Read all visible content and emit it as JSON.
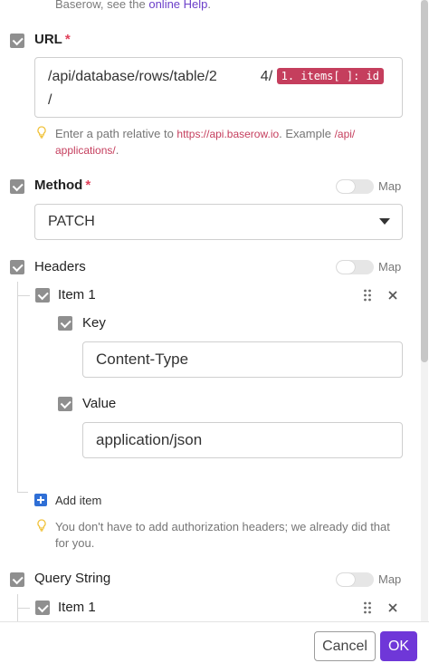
{
  "intro": {
    "text": "Baserow, see the ",
    "link": "online Help",
    "tail": "."
  },
  "url_field": {
    "label": "URL",
    "required_mark": "*",
    "value_prefix": "/api/database/rows/table/2",
    "value_suffix": "4/",
    "token": "1. items[ ]: id",
    "value_tail": " /",
    "hint_text": "Enter a path relative to ",
    "hint_link": "https://api.baserow.io",
    "hint_mid": ". Example ",
    "hint_example": "/api/ applications/",
    "hint_end": "."
  },
  "method_field": {
    "label": "Method",
    "required_mark": "*",
    "map_label": "Map",
    "selected": "PATCH"
  },
  "headers_field": {
    "label": "Headers",
    "map_label": "Map",
    "item_label": "Item 1",
    "key_label": "Key",
    "key_value": "Content-Type",
    "value_label": "Value",
    "value_value": "application/json",
    "add_item_label": "Add item",
    "hint_text": "You don't have to add authorization headers; we already did that for you."
  },
  "query_field": {
    "label": "Query String",
    "map_label": "Map",
    "item_label": "Item 1"
  },
  "footer": {
    "cancel_label": "Cancel",
    "ok_label": "OK"
  },
  "colors": {
    "accent": "#6f37d8",
    "token": "#c53e5d",
    "required": "#e0415a",
    "add": "#2f6fd6"
  },
  "icons": [
    "checkbox-icon",
    "lightbulb-icon",
    "chevron-down-icon",
    "drag-handle-icon",
    "close-icon",
    "plus-icon"
  ]
}
